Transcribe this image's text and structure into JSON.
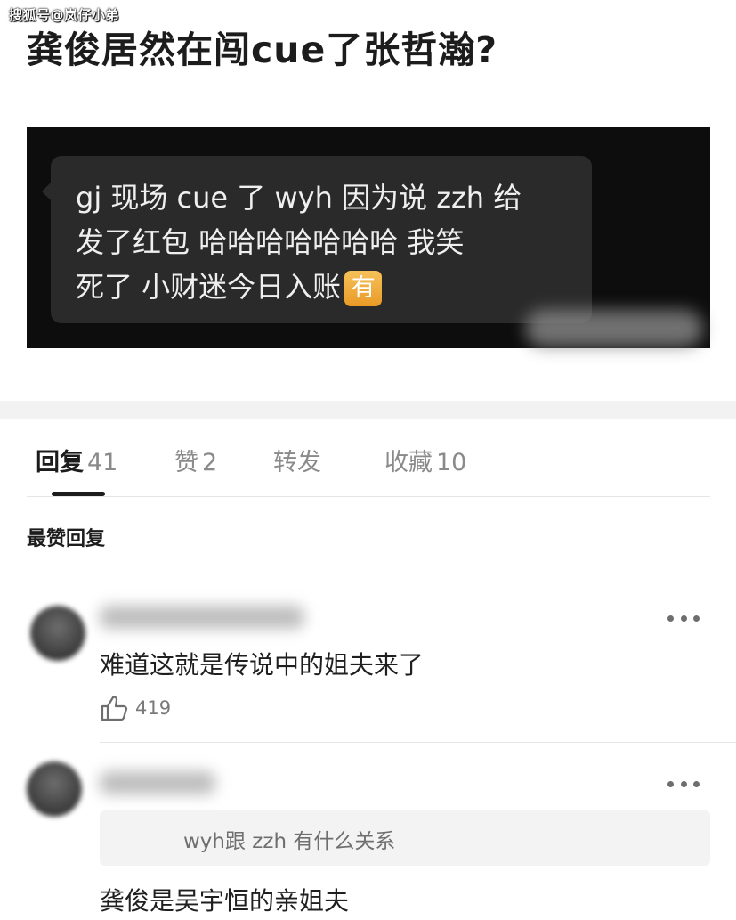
{
  "watermark": "搜狐号@岚仔小弟",
  "post": {
    "title": "龚俊居然在闯cue了张哲瀚?",
    "image_chat": {
      "line1": "gj 现场 cue 了 wyh  因为说 zzh 给",
      "line2": "发了红包 哈哈哈哈哈哈哈 我笑",
      "line3": "死了 小财迷今日入账",
      "emoji_label": "有"
    }
  },
  "tabs": [
    {
      "label": "回复",
      "count": "41"
    },
    {
      "label": "赞",
      "count": "2"
    },
    {
      "label": "转发",
      "count": ""
    },
    {
      "label": "收藏",
      "count": "10"
    }
  ],
  "section_label": "最赞回复",
  "comments": [
    {
      "text": "难道这就是传说中的姐夫来了",
      "likes": "419"
    },
    {
      "quoted": "wyh跟 zzh 有什么关系",
      "text": "龚俊是吴宇恒的亲姐夫"
    }
  ],
  "colors": {
    "text": "#1c1c1c",
    "muted": "#8a8a8a",
    "bubble": "#2a2a2a",
    "emoji_bg": "#e99a26"
  }
}
